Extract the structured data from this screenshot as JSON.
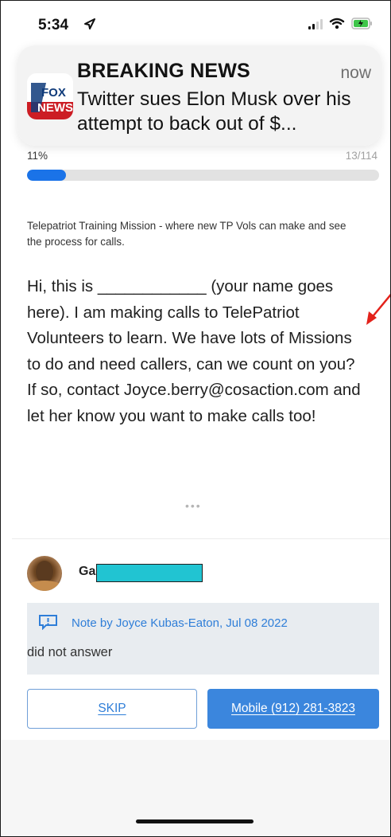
{
  "status_bar": {
    "time": "5:34",
    "icons": [
      "location-arrow-icon",
      "signal-icon",
      "wifi-icon",
      "battery-icon"
    ],
    "battery_color": "#3fc54a"
  },
  "notification": {
    "title": "BREAKING NEWS",
    "time": "now",
    "body": "Twitter sues Elon Musk over his attempt to back out of $...",
    "logo_text_top": "FOX",
    "logo_text_bottom": "NEWS"
  },
  "progress": {
    "percent_label": "11%",
    "count_label": "13/114",
    "value": 0.11,
    "accent_color": "#1a73e8"
  },
  "mission": {
    "description": "Telepatriot Training Mission - where new TP Vols can make and see the process for calls.",
    "script": "Hi, this is ____________ (your name goes here).   I am making calls to TelePatriot Volunteers to learn. We have lots of Missions to do and need callers, can we count on you? If so, contact Joyce.berry@cosaction.com and let her know you want to make calls too!"
  },
  "ellipsis": "•••",
  "contact": {
    "name": "Ga",
    "note_author": "Note by Joyce Kubas-Eaton, Jul 08 2022",
    "note_text": "did not answer"
  },
  "actions": {
    "skip_label": "SKIP",
    "call_label": "Mobile (912) 281-3823"
  }
}
